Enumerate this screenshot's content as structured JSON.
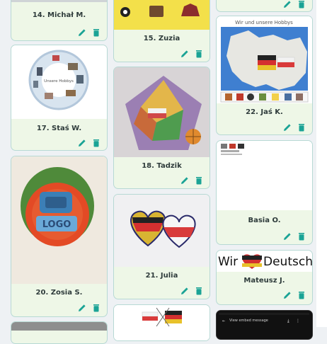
{
  "colors": {
    "accent": "#1aa395",
    "card_bg": "#eef7e7",
    "card_border": "#b7d9d4",
    "caption": "#2e3b3b"
  },
  "icons": {
    "edit": "pencil-icon",
    "delete": "trash-icon"
  },
  "posts": [
    {
      "caption": "14. Michał M."
    },
    {
      "caption": "17. Staś W.",
      "image_text": "Unsere Hobbys"
    },
    {
      "caption": "20. Zosia S.",
      "image_text": "LOGO"
    },
    {
      "caption": "15. Zuzia"
    },
    {
      "caption": "18. Tadzik"
    },
    {
      "caption": "21. Julia"
    },
    {
      "caption": "22. Jaś K.",
      "image_title": "Wir und unsere Hobbys"
    },
    {
      "caption": "Basia O."
    },
    {
      "caption": "Mateusz J.",
      "image_text_left": "Wir",
      "image_text_right": "Deutsch"
    },
    {
      "image_text": "View embed message"
    }
  ]
}
